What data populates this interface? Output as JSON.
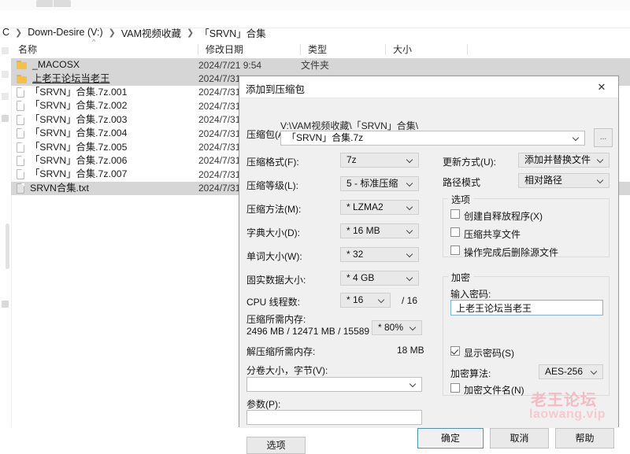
{
  "explorer": {
    "breadcrumb": [
      "C",
      "Down-Desire (V:)",
      "VAM视频收藏",
      "「SRVN」合集"
    ],
    "columns": [
      "名称",
      "修改日期",
      "类型",
      "大小"
    ],
    "rows": [
      {
        "icon": "folder-icon",
        "name": "_MACOSX",
        "date": "2024/7/21 9:54",
        "type": "文件夹",
        "size": "",
        "selected": true,
        "underline": false
      },
      {
        "icon": "folder-icon",
        "name": "上老王论坛当老王",
        "date": "2024/7/31",
        "type": "",
        "size": "",
        "selected": true,
        "underline": true
      },
      {
        "icon": "document-icon",
        "name": "「SRVN」合集.7z.001",
        "date": "2024/7/31",
        "type": "",
        "size": "",
        "selected": false,
        "underline": false
      },
      {
        "icon": "document-icon",
        "name": "「SRVN」合集.7z.002",
        "date": "2024/7/31",
        "type": "",
        "size": "",
        "selected": false,
        "underline": false
      },
      {
        "icon": "document-icon",
        "name": "「SRVN」合集.7z.003",
        "date": "2024/7/31",
        "type": "",
        "size": "",
        "selected": false,
        "underline": false
      },
      {
        "icon": "document-icon",
        "name": "「SRVN」合集.7z.004",
        "date": "2024/7/31",
        "type": "",
        "size": "",
        "selected": false,
        "underline": false
      },
      {
        "icon": "document-icon",
        "name": "「SRVN」合集.7z.005",
        "date": "2024/7/31",
        "type": "",
        "size": "",
        "selected": false,
        "underline": false
      },
      {
        "icon": "document-icon",
        "name": "「SRVN」合集.7z.006",
        "date": "2024/7/31",
        "type": "",
        "size": "",
        "selected": false,
        "underline": false
      },
      {
        "icon": "document-icon",
        "name": "「SRVN」合集.7z.007",
        "date": "2024/7/31",
        "type": "",
        "size": "",
        "selected": false,
        "underline": false
      },
      {
        "icon": "document-grey-icon",
        "name": "SRVN合集.txt",
        "date": "2024/7/31",
        "type": "",
        "size": "",
        "selected": true,
        "underline": false
      }
    ]
  },
  "dialog": {
    "title": "添加到压缩包",
    "close_icon": "close-icon",
    "archive": {
      "label": "压缩包(A):",
      "path": "V:\\VAM视频收藏\\「SRVN」合集\\",
      "value": "「SRVN」合集.7z",
      "browse_label": "..."
    },
    "left_fields": [
      {
        "label": "压缩格式(F):",
        "value": "7z"
      },
      {
        "label": "压缩等级(L):",
        "value": "5 - 标准压缩"
      },
      {
        "label": "压缩方法(M):",
        "value": "*  LZMA2"
      },
      {
        "label": "字典大小(D):",
        "value": "*  16 MB"
      },
      {
        "label": "单词大小(W):",
        "value": "*  32"
      },
      {
        "label": "固实数据大小:",
        "value": "*  4 GB"
      },
      {
        "label": "CPU 线程数:",
        "value": "*  16"
      }
    ],
    "cpu_threads_total": "/ 16",
    "memory": {
      "compress_label": "压缩所需内存:",
      "compress_value": "2496 MB / 12471 MB / 15589 MB",
      "compress_percent": "*  80%",
      "decompress_label": "解压缩所需内存:",
      "decompress_value": "18 MB"
    },
    "volume": {
      "label": "分卷大小，字节(V):",
      "value": ""
    },
    "params": {
      "label": "参数(P):",
      "value": ""
    },
    "options_button": "选项",
    "update_mode": {
      "label": "更新方式(U):",
      "value": "添加并替换文件"
    },
    "path_mode": {
      "label": "路径模式",
      "value": "相对路径"
    },
    "options_group": {
      "title": "选项",
      "items": [
        {
          "label": "创建自释放程序(X)",
          "checked": false
        },
        {
          "label": "压缩共享文件",
          "checked": false
        },
        {
          "label": "操作完成后删除源文件",
          "checked": false
        }
      ]
    },
    "encryption_group": {
      "title": "加密",
      "password_label": "输入密码:",
      "password_value": "上老王论坛当老王",
      "show_password": {
        "label": "显示密码(S)",
        "checked": true
      },
      "algorithm_label": "加密算法:",
      "algorithm_value": "AES-256",
      "encrypt_names": {
        "label": "加密文件名(N)",
        "checked": false
      }
    },
    "buttons": {
      "ok": "确定",
      "cancel": "取消",
      "help": "帮助"
    }
  },
  "watermark": {
    "line1": "老王论坛",
    "line2": "laowang.vip",
    "color": "#f3bcc4"
  }
}
